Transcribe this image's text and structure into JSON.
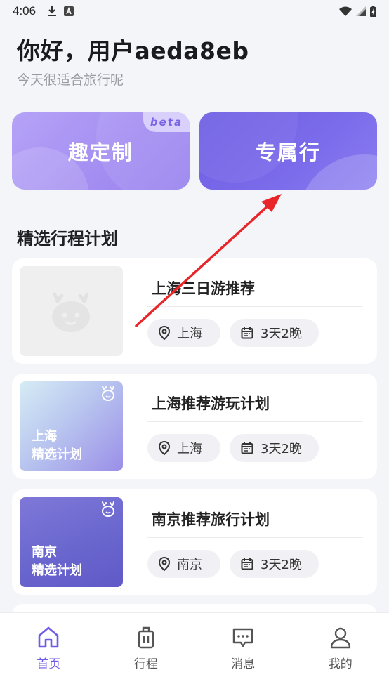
{
  "status_bar": {
    "time": "4:06"
  },
  "header": {
    "greeting": "你好，用户aeda8eb",
    "subtitle": "今天很适合旅行呢"
  },
  "actions": {
    "custom": {
      "label": "趣定制",
      "badge": "beta"
    },
    "exclusive": {
      "label": "专属行"
    }
  },
  "section": {
    "title": "精选行程计划"
  },
  "plans": [
    {
      "title": "上海三日游推荐",
      "location": "上海",
      "duration": "3天2晚",
      "thumb_text": []
    },
    {
      "title": "上海推荐游玩计划",
      "location": "上海",
      "duration": "3天2晚",
      "thumb_text": [
        "上海",
        "精选计划"
      ]
    },
    {
      "title": "南京推荐旅行计划",
      "location": "南京",
      "duration": "3天2晚",
      "thumb_text": [
        "南京",
        "精选计划"
      ]
    }
  ],
  "tabs": [
    {
      "label": "首页",
      "icon": "home-icon",
      "active": true
    },
    {
      "label": "行程",
      "icon": "luggage-icon",
      "active": false
    },
    {
      "label": "消息",
      "icon": "message-icon",
      "active": false
    },
    {
      "label": "我的",
      "icon": "profile-icon",
      "active": false
    }
  ],
  "colors": {
    "accent": "#6d5ae6",
    "annotation_arrow": "#e8262a"
  }
}
